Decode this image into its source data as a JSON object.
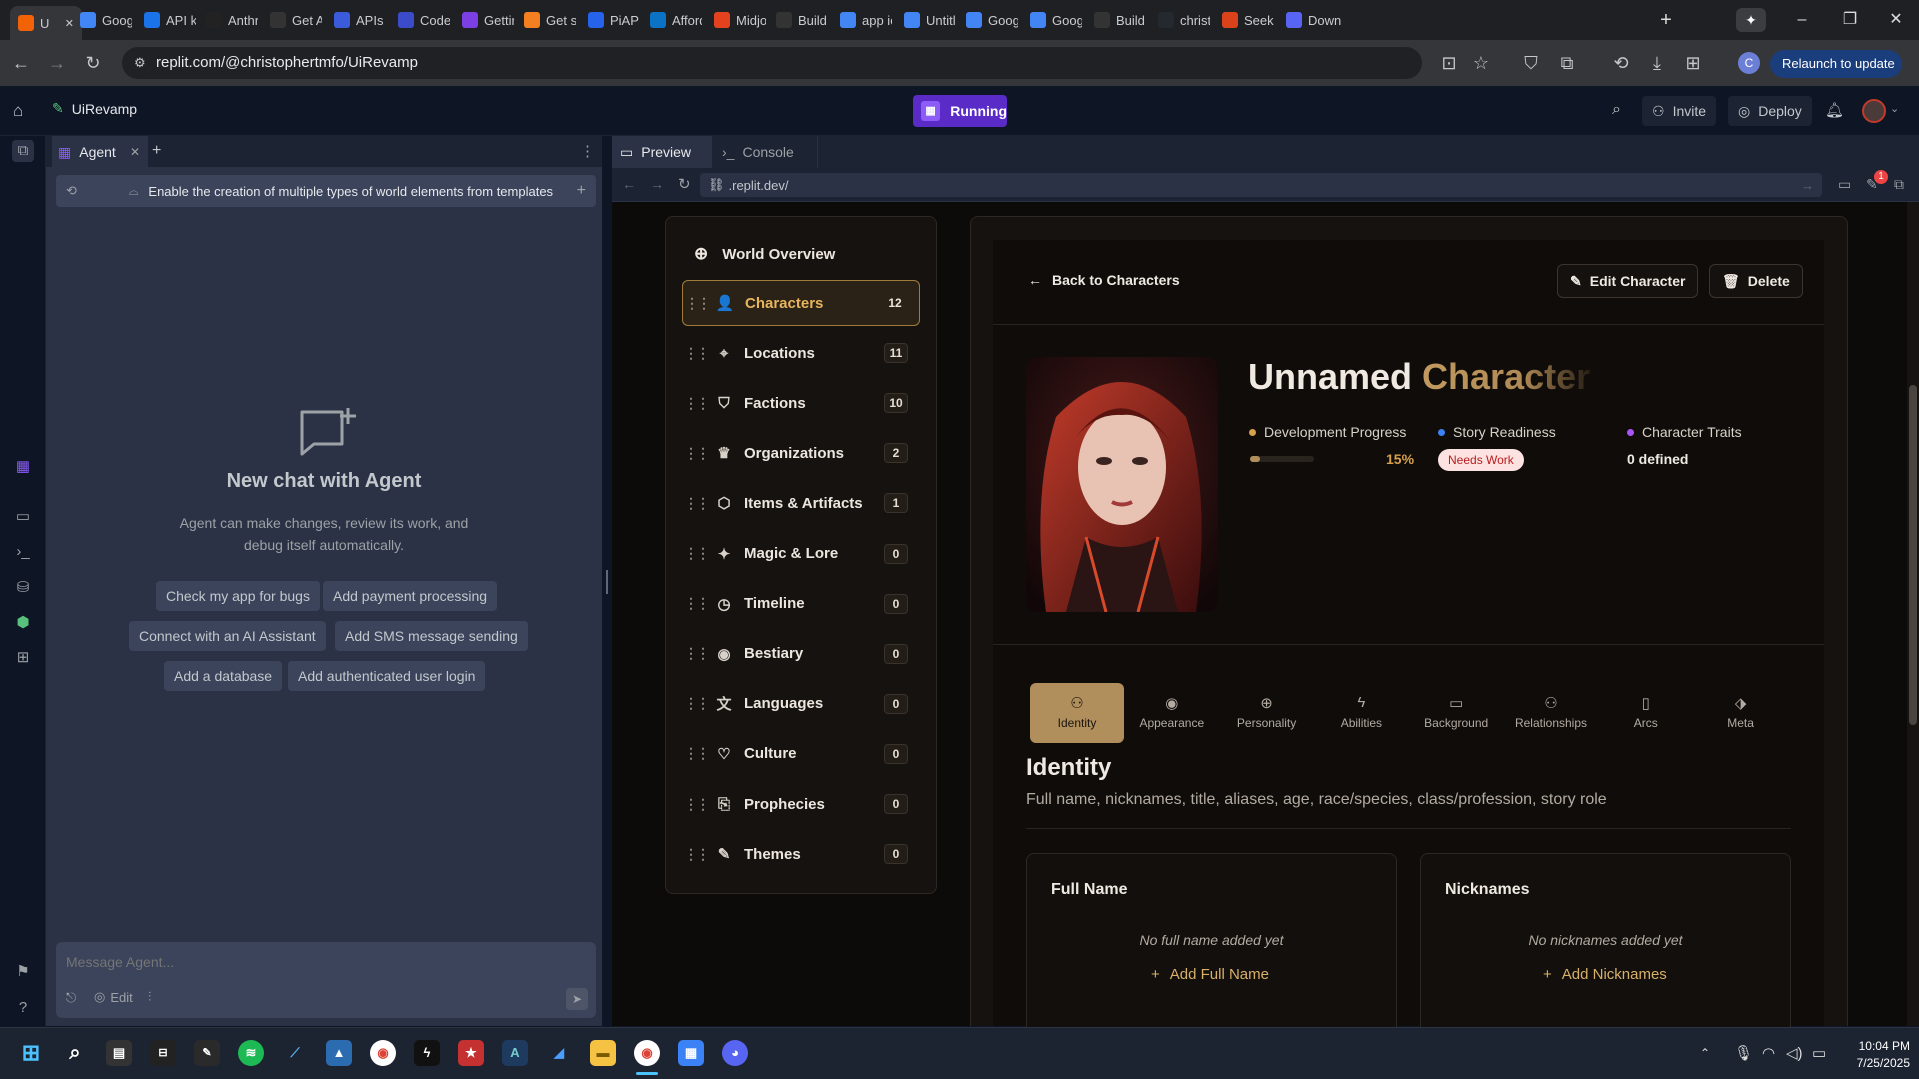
{
  "browser": {
    "tabs": [
      {
        "label": "U",
        "active": true,
        "favicon_color": "#f26207"
      },
      {
        "label": "Goog",
        "favicon_color": "#4285f4"
      },
      {
        "label": "API k",
        "favicon_color": "#1a73e8"
      },
      {
        "label": "Anthr",
        "favicon_color": "#222222"
      },
      {
        "label": "Get A",
        "favicon_color": "#333333"
      },
      {
        "label": "APIs &",
        "favicon_color": "#3b5bdb"
      },
      {
        "label": "Code",
        "favicon_color": "#3b4cca"
      },
      {
        "label": "Gettin",
        "favicon_color": "#7b3fe4"
      },
      {
        "label": "Get st",
        "favicon_color": "#f38020"
      },
      {
        "label": "PiAPI",
        "favicon_color": "#2563eb"
      },
      {
        "label": "Afford",
        "favicon_color": "#0b72c6"
      },
      {
        "label": "Midjo",
        "favicon_color": "#e4421e"
      },
      {
        "label": "Build",
        "favicon_color": "#333333"
      },
      {
        "label": "app ic",
        "favicon_color": "#4285f4"
      },
      {
        "label": "Untitl",
        "favicon_color": "#4285f4"
      },
      {
        "label": "Goog",
        "favicon_color": "#4285f4"
      },
      {
        "label": "Goog",
        "favicon_color": "#4285f4"
      },
      {
        "label": "Build",
        "favicon_color": "#333333"
      },
      {
        "label": "christ",
        "favicon_color": "#24292f"
      },
      {
        "label": "Seeki",
        "favicon_color": "#d9421b"
      },
      {
        "label": "Down",
        "favicon_color": "#5865f2"
      }
    ],
    "url": "replit.com/@christophertmfo/UiRevamp",
    "relaunch_label": "Relaunch to update",
    "profile_initial": "C"
  },
  "replit": {
    "project_name": "UiRevamp",
    "run_status": "Running",
    "invite_label": "Invite",
    "deploy_label": "Deploy"
  },
  "agent": {
    "tab_label": "Agent",
    "context_text": "Enable the creation of multiple types of world elements from templates",
    "title": "New chat with Agent",
    "subtitle": "Agent can make changes, review its work, and debug itself automatically.",
    "suggestions": [
      "Check my app for bugs",
      "Add payment processing",
      "Connect with an AI Assistant",
      "Add SMS message sending",
      "Add a database",
      "Add authenticated user login"
    ],
    "input_placeholder": "Message Agent...",
    "edit_label": "Edit"
  },
  "preview": {
    "tab_preview": "Preview",
    "tab_console": "Console",
    "url": ".replit.dev/",
    "notification_count": "1"
  },
  "world": {
    "overview_label": "World Overview",
    "items": [
      {
        "label": "Characters",
        "count": "12",
        "icon": "users-icon",
        "glyph": "👤",
        "active": true
      },
      {
        "label": "Locations",
        "count": "11",
        "icon": "map-pin-icon",
        "glyph": "⌖"
      },
      {
        "label": "Factions",
        "count": "10",
        "icon": "shield-icon",
        "glyph": "⛉"
      },
      {
        "label": "Organizations",
        "count": "2",
        "icon": "crown-icon",
        "glyph": "♛"
      },
      {
        "label": "Items & Artifacts",
        "count": "1",
        "icon": "package-icon",
        "glyph": "⬡"
      },
      {
        "label": "Magic & Lore",
        "count": "0",
        "icon": "sparkles-icon",
        "glyph": "✦"
      },
      {
        "label": "Timeline",
        "count": "0",
        "icon": "clock-icon",
        "glyph": "◷"
      },
      {
        "label": "Bestiary",
        "count": "0",
        "icon": "eye-icon",
        "glyph": "◉"
      },
      {
        "label": "Languages",
        "count": "0",
        "icon": "languages-icon",
        "glyph": "文"
      },
      {
        "label": "Culture",
        "count": "0",
        "icon": "heart-icon",
        "glyph": "♡"
      },
      {
        "label": "Prophecies",
        "count": "0",
        "icon": "scroll-icon",
        "glyph": "⎘"
      },
      {
        "label": "Themes",
        "count": "0",
        "icon": "brush-icon",
        "glyph": "✎"
      }
    ]
  },
  "character": {
    "back_label": "Back to Characters",
    "edit_label": "Edit Character",
    "delete_label": "Delete",
    "name_part1": "Unnamed",
    "name_part2": "Character",
    "stats": {
      "development_label": "Development Progress",
      "development_value": "15%",
      "development_progress": 0.15,
      "readiness_label": "Story Readiness",
      "readiness_badge": "Needs Work",
      "traits_label": "Character Traits",
      "traits_value": "0 defined"
    },
    "tabs": [
      {
        "label": "Identity",
        "icon": "user-icon",
        "glyph": "⚇",
        "active": true
      },
      {
        "label": "Appearance",
        "icon": "eye-icon",
        "glyph": "◉"
      },
      {
        "label": "Personality",
        "icon": "brain-icon",
        "glyph": "⊕"
      },
      {
        "label": "Abilities",
        "icon": "zap-icon",
        "glyph": "ϟ"
      },
      {
        "label": "Background",
        "icon": "book-icon",
        "glyph": "▭"
      },
      {
        "label": "Relationships",
        "icon": "users-icon",
        "glyph": "⚇"
      },
      {
        "label": "Arcs",
        "icon": "book-open-icon",
        "glyph": "▯"
      },
      {
        "label": "Meta",
        "icon": "tag-icon",
        "glyph": "⬗"
      }
    ],
    "section_title": "Identity",
    "section_subtitle": "Full name, nicknames, title, aliases, age, race/species, class/profession, story role",
    "cards": [
      {
        "title": "Full Name",
        "empty": "No full name added yet",
        "action": "Add Full Name"
      },
      {
        "title": "Nicknames",
        "empty": "No nicknames added yet",
        "action": "Add Nicknames"
      }
    ]
  },
  "taskbar": {
    "time": "10:04 PM",
    "date": "7/25/2025"
  },
  "colors": {
    "accent_gold": "#d8b06a",
    "running_purple": "#7c3aed",
    "badge_red": "#ef4444"
  }
}
